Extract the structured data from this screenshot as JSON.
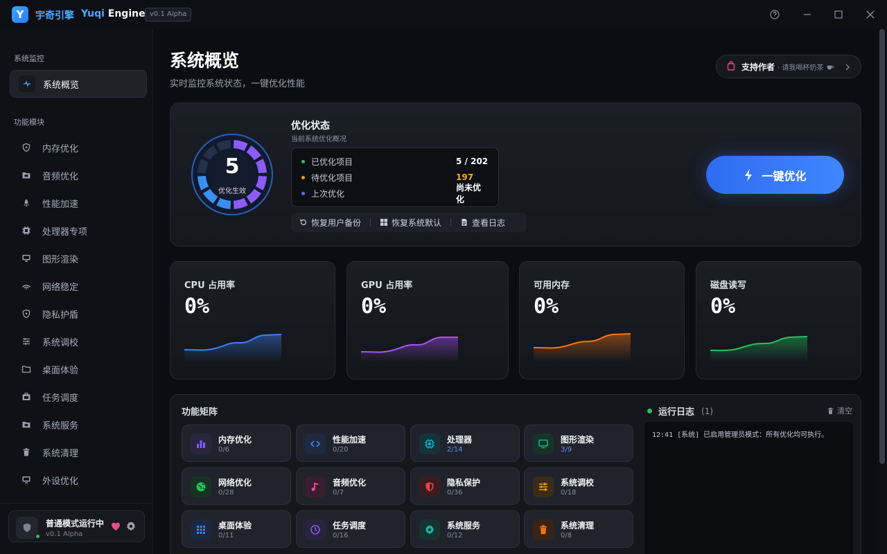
{
  "titlebar": {
    "logo_letter": "Y",
    "app_name_cn": "宇奇引擎",
    "app_name_en_1": "Yuqi",
    "app_name_en_2": "Engine",
    "version": "v0.1 Alpha"
  },
  "sidebar": {
    "section_monitor": "系统监控",
    "active_item": "系统概览",
    "section_modules": "功能模块",
    "items": [
      {
        "label": "内存优化",
        "icon": "shield-icon"
      },
      {
        "label": "音频优化",
        "icon": "folder-icon"
      },
      {
        "label": "性能加速",
        "icon": "rocket-icon"
      },
      {
        "label": "处理器专项",
        "icon": "chip-icon"
      },
      {
        "label": "图形渲染",
        "icon": "monitor-icon"
      },
      {
        "label": "网络稳定",
        "icon": "wifi-icon"
      },
      {
        "label": "隐私护盾",
        "icon": "shield-icon"
      },
      {
        "label": "系统调校",
        "icon": "sliders-icon"
      },
      {
        "label": "桌面体验",
        "icon": "folder-icon"
      },
      {
        "label": "任务调度",
        "icon": "briefcase-icon"
      },
      {
        "label": "系统服务",
        "icon": "folder-icon"
      },
      {
        "label": "系统清理",
        "icon": "trash-icon"
      },
      {
        "label": "外设优化",
        "icon": "monitor-icon"
      }
    ],
    "status": {
      "title": "普通模式运行中",
      "version": "v0.1 Alpha"
    }
  },
  "header": {
    "title": "系统概览",
    "subtitle": "实时监控系统状态，一键优化性能",
    "support_label": "支持作者",
    "support_sub": "· 请我喝杯奶茶"
  },
  "hero": {
    "ring_value": "5",
    "ring_label": "优化生效",
    "ring_progress": 0.75,
    "title": "优化状态",
    "subtitle": "当前系统优化概况",
    "stats": [
      {
        "key": "已优化项目",
        "value": "5 / 202",
        "color": "#22c55e",
        "value_color": "#ffffff"
      },
      {
        "key": "待优化项目",
        "value": "197",
        "color": "#f59e0b",
        "value_color": "#f5a623"
      },
      {
        "key": "上次优化",
        "value": "尚未优化",
        "color": "#6366f1",
        "value_color": "#ffffff"
      }
    ],
    "actions": [
      "恢复用户备份",
      "恢复系统默认",
      "查看日志"
    ],
    "optimize_button": "一键优化"
  },
  "metrics": [
    {
      "title": "CPU 占用率",
      "value": "0%",
      "color": "#3b82f6"
    },
    {
      "title": "GPU 占用率",
      "value": "0%",
      "color": "#a855f7"
    },
    {
      "title": "可用内存",
      "value": "0%",
      "color": "#f97316"
    },
    {
      "title": "磁盘读写",
      "value": "0%",
      "color": "#22c55e"
    }
  ],
  "matrix": {
    "title": "功能矩阵",
    "tiles": [
      {
        "name": "内存优化",
        "count": "0/6",
        "icon": "bar-chart-icon",
        "color": "#7c5cff",
        "count_color": "#848a98"
      },
      {
        "name": "性能加速",
        "count": "0/20",
        "icon": "code-icon",
        "color": "#3b82f6",
        "count_color": "#848a98"
      },
      {
        "name": "处理器",
        "count": "2/14",
        "icon": "chip-icon",
        "color": "#06b6d4",
        "count_color": "#6b8cff"
      },
      {
        "name": "图形渲染",
        "count": "3/9",
        "icon": "monitor-icon",
        "color": "#10b981",
        "count_color": "#6b8cff"
      },
      {
        "name": "网络优化",
        "count": "0/28",
        "icon": "globe-icon",
        "color": "#22c55e",
        "count_color": "#848a98"
      },
      {
        "name": "音频优化",
        "count": "0/7",
        "icon": "music-icon",
        "color": "#ec4899",
        "count_color": "#848a98"
      },
      {
        "name": "隐私保护",
        "count": "0/36",
        "icon": "shield-icon",
        "color": "#ef4444",
        "count_color": "#848a98"
      },
      {
        "name": "系统调校",
        "count": "0/18",
        "icon": "sliders-icon",
        "color": "#f59e0b",
        "count_color": "#848a98"
      },
      {
        "name": "桌面体验",
        "count": "0/11",
        "icon": "grid-icon",
        "color": "#3b82f6",
        "count_color": "#848a98"
      },
      {
        "name": "任务调度",
        "count": "0/16",
        "icon": "clock-icon",
        "color": "#8b5cf6",
        "count_color": "#848a98"
      },
      {
        "name": "系统服务",
        "count": "0/12",
        "icon": "gear-icon",
        "color": "#14b8a6",
        "count_color": "#848a98"
      },
      {
        "name": "系统清理",
        "count": "0/8",
        "icon": "trash-icon",
        "color": "#f97316",
        "count_color": "#848a98"
      }
    ]
  },
  "log": {
    "title": "运行日志",
    "count": "(1)",
    "clear": "清空",
    "lines": [
      "12:41 [系统] 已启用管理员模式：所有优化均可执行。"
    ]
  }
}
